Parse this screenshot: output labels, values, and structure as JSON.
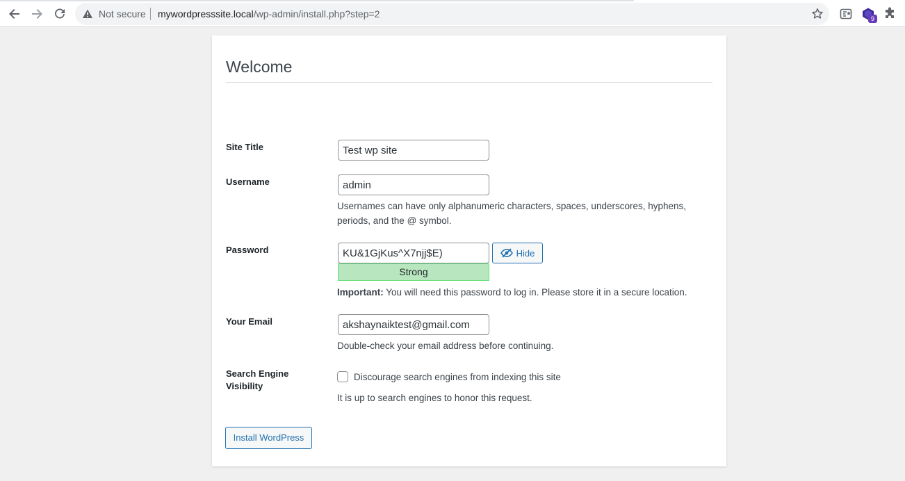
{
  "browser": {
    "security_label": "Not secure",
    "url_host": "mywordpresssite.local",
    "url_path": "/wp-admin/install.php?step=2",
    "extension_badge": "9",
    "icons": [
      "back-icon",
      "forward-icon",
      "reload-icon",
      "warning-icon",
      "star-icon",
      "reading-list-icon",
      "extension-icon",
      "puzzle-icon"
    ]
  },
  "page": {
    "heading": "Welcome"
  },
  "form": {
    "site_title": {
      "label": "Site Title",
      "value": "Test wp site"
    },
    "username": {
      "label": "Username",
      "value": "admin",
      "description_line1": "Usernames can have only alphanumeric characters, spaces, underscores, hyphens,",
      "description_line2": "periods, and the @ symbol."
    },
    "password": {
      "label": "Password",
      "value": "KU&1GjKus^X7njj$E)",
      "strength": "Strong",
      "hide_label": "Hide",
      "important_label": "Important:",
      "important_text": "You will need this password to log in. Please store it in a secure location."
    },
    "email": {
      "label": "Your Email",
      "value": "akshaynaiktest@gmail.com",
      "description": "Double-check your email address before continuing."
    },
    "search_visibility": {
      "label_line1": "Search Engine",
      "label_line2": "Visibility",
      "checkbox_label": "Discourage search engines from indexing this site",
      "checked": false,
      "description": "It is up to search engines to honor this request."
    },
    "submit_label": "Install WordPress"
  },
  "colors": {
    "accent": "#2271b1",
    "strength_bg": "#b8e6bf",
    "background": "#f0f0f1"
  }
}
